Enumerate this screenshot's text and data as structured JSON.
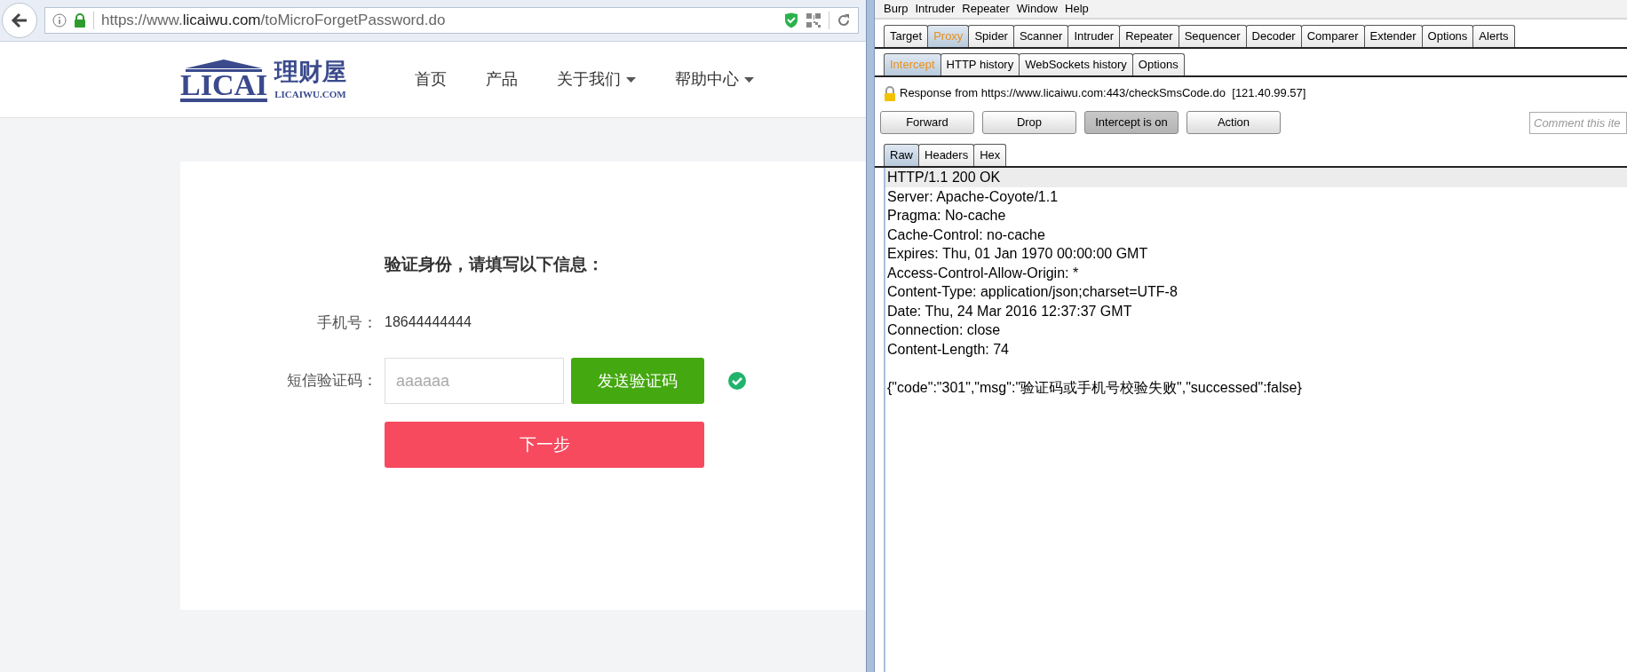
{
  "browser": {
    "url_parts": [
      "https://www.",
      "licaiwu.com",
      "/toMicroForgetPassword.do"
    ]
  },
  "site": {
    "logo": {
      "mark": "LICAI",
      "name": "理财屋",
      "domain": "LICAIWU.COM"
    },
    "nav": [
      {
        "label": "首页",
        "dropdown": false
      },
      {
        "label": "产品",
        "dropdown": false
      },
      {
        "label": "关于我们",
        "dropdown": true
      },
      {
        "label": "帮助中心",
        "dropdown": true
      }
    ]
  },
  "form": {
    "heading": "验证身份，请填写以下信息：",
    "phone_label": "手机号：",
    "phone_value": "18644444444",
    "sms_label": "短信验证码：",
    "sms_placeholder": "aaaaaa",
    "send_button": "发送验证码",
    "verified": true,
    "next_button": "下一步"
  },
  "burp": {
    "menu": [
      "Burp",
      "Intruder",
      "Repeater",
      "Window",
      "Help"
    ],
    "tabs": [
      {
        "label": "Target",
        "selected": false
      },
      {
        "label": "Proxy",
        "selected": true
      },
      {
        "label": "Spider",
        "selected": false
      },
      {
        "label": "Scanner",
        "selected": false
      },
      {
        "label": "Intruder",
        "selected": false
      },
      {
        "label": "Repeater",
        "selected": false
      },
      {
        "label": "Sequencer",
        "selected": false
      },
      {
        "label": "Decoder",
        "selected": false
      },
      {
        "label": "Comparer",
        "selected": false
      },
      {
        "label": "Extender",
        "selected": false
      },
      {
        "label": "Options",
        "selected": false
      },
      {
        "label": "Alerts",
        "selected": false
      }
    ],
    "subtabs": [
      {
        "label": "Intercept",
        "selected": true
      },
      {
        "label": "HTTP history",
        "selected": false
      },
      {
        "label": "WebSockets history",
        "selected": false
      },
      {
        "label": "Options",
        "selected": false
      }
    ],
    "response_info": "Response from https://www.licaiwu.com:443/checkSmsCode.do  [121.40.99.57]",
    "buttons": [
      {
        "label": "Forward",
        "pressed": false
      },
      {
        "label": "Drop",
        "pressed": false
      },
      {
        "label": "Intercept is on",
        "pressed": true
      },
      {
        "label": "Action",
        "pressed": false
      }
    ],
    "comment_placeholder": "Comment this ite",
    "view_tabs": [
      {
        "label": "Raw",
        "selected": true
      },
      {
        "label": "Headers",
        "selected": false
      },
      {
        "label": "Hex",
        "selected": false
      }
    ],
    "headers": [
      {
        "text": "HTTP/1.1 200 OK",
        "selected": true
      },
      {
        "text": "Server: Apache-Coyote/1.1",
        "selected": false
      },
      {
        "text": "Pragma: No-cache",
        "selected": false
      },
      {
        "text": "Cache-Control: no-cache",
        "selected": false
      },
      {
        "text": "Expires: Thu, 01 Jan 1970 00:00:00 GMT",
        "selected": false
      },
      {
        "text": "Access-Control-Allow-Origin: *",
        "selected": false
      },
      {
        "text": "Content-Type: application/json;charset=UTF-8",
        "selected": false
      },
      {
        "text": "Date: Thu, 24 Mar 2016 12:37:37 GMT",
        "selected": false
      },
      {
        "text": "Connection: close",
        "selected": false
      },
      {
        "text": "Content-Length: 74",
        "selected": false
      }
    ],
    "body": "{\"code\":\"301\",\"msg\":\"验证码或手机号校验失败\",\"successed\":false}"
  }
}
